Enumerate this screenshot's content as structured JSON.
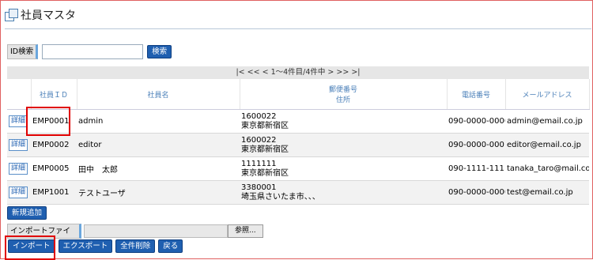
{
  "page": {
    "title": "社員マスタ"
  },
  "search": {
    "label": "ID検索",
    "value": "",
    "button": "検索"
  },
  "pager": {
    "text": "|<   <<   <   1～4件目/4件中   >   >>   >|"
  },
  "table": {
    "headers": {
      "id": "社員ＩＤ",
      "name": "社員名",
      "zip": "郵便番号",
      "address": "住所",
      "phone": "電話番号",
      "email": "メールアドレス"
    },
    "detail_label": "詳細",
    "rows": [
      {
        "id": "EMP0001",
        "name": "admin",
        "zip": "1600022",
        "address": "東京都新宿区",
        "phone": "090-0000-0000",
        "email": "admin@email.co.jp"
      },
      {
        "id": "EMP0002",
        "name": "editor",
        "zip": "1600022",
        "address": "東京都新宿区",
        "phone": "090-0000-0001",
        "email": "editor@email.co.jp"
      },
      {
        "id": "EMP0005",
        "name": "田中　太郎",
        "zip": "1111111",
        "address": "東京都新宿区",
        "phone": "090-1111-1111",
        "email": "tanaka_taro@mail.co.jp"
      },
      {
        "id": "EMP1001",
        "name": "テストユーザ",
        "zip": "3380001",
        "address": "埼玉県さいたま市、、、",
        "phone": "090-0000-0000",
        "email": "test@email.co.jp"
      }
    ]
  },
  "buttons": {
    "new": "新規追加",
    "import_file_label": "インポートファイル",
    "browse": "参照...",
    "import": "インポート",
    "export": "エクスポート",
    "delete_all": "全件削除",
    "back": "戻る"
  },
  "colors": {
    "button_blue": "#1f5fb0",
    "header_text": "#4a7fb8",
    "highlight": "#e00000"
  }
}
